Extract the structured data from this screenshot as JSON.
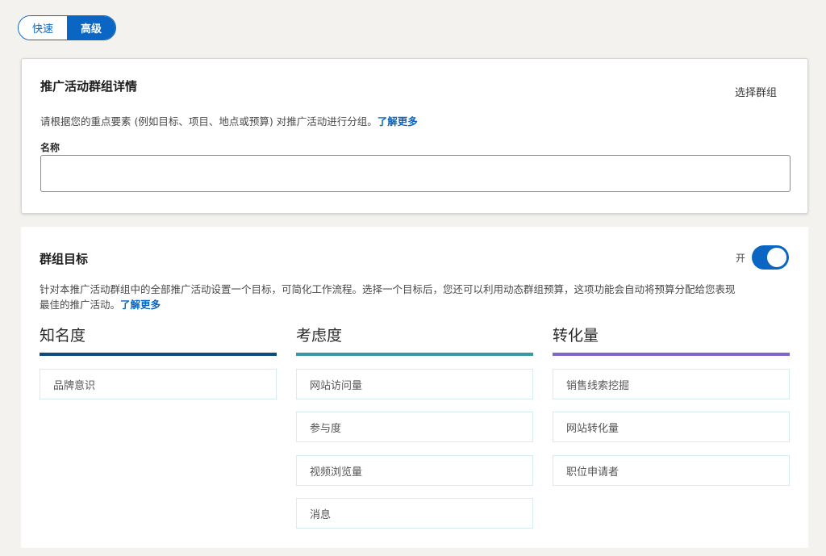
{
  "mode_toggle": {
    "quick_label": "快速",
    "advanced_label": "高级",
    "selected": "高级"
  },
  "details_card": {
    "title": "推广活动群组详情",
    "select_group_label": "选择群组",
    "description": "请根据您的重点要素 (例如目标、项目、地点或预算) 对推广活动进行分组。",
    "learn_more": "了解更多",
    "name_label": "名称",
    "name_value": ""
  },
  "objective_card": {
    "title": "群组目标",
    "switch_label": "开",
    "switch_on": true,
    "description_line1": "针对本推广活动群组中的全部推广活动设置一个目标，可简化工作流程。选择一个目标后，您还可以利用动态群组预算，这项功能会自动将预算分配给您表现",
    "description_line2": "最佳的推广活动。",
    "learn_more": "了解更多",
    "columns": [
      {
        "title": "知名度",
        "color": "#0e4d7b",
        "options": [
          "品牌意识"
        ]
      },
      {
        "title": "考虑度",
        "color": "#3a98a6",
        "options": [
          "网站访问量",
          "参与度",
          "视频浏览量",
          "消息"
        ]
      },
      {
        "title": "转化量",
        "color": "#7b68c9",
        "options": [
          "销售线索挖掘",
          "网站转化量",
          "职位申请者"
        ]
      }
    ]
  }
}
